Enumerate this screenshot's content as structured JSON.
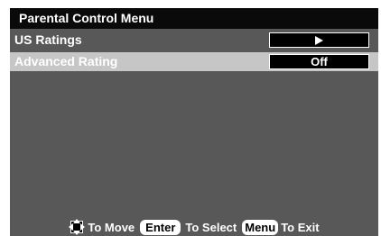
{
  "menu": {
    "title": "Parental Control Menu",
    "items": [
      {
        "label": "US Ratings",
        "value_icon": "play-arrow-icon",
        "selected": false
      },
      {
        "label": "Advanced Rating",
        "value": "Off",
        "selected": true
      }
    ]
  },
  "footer": {
    "move_icon": "dpad-arrows-icon",
    "move_text": "To Move",
    "enter_key": "Enter",
    "select_text": "To Select",
    "menu_key": "Menu",
    "exit_text": "To Exit"
  },
  "colors": {
    "panel_bg": "#585858",
    "title_bg": "#0a0a0a",
    "highlight_bg": "#c6c6c6",
    "text": "#ffffff",
    "value_box": "#000000"
  }
}
